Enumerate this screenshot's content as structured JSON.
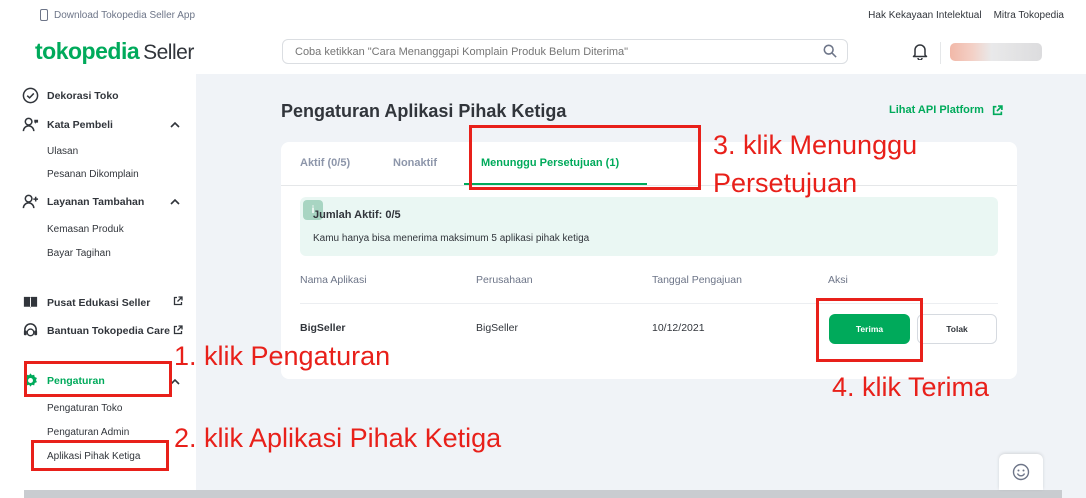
{
  "topbar": {
    "download_app": "Download Tokopedia Seller App",
    "links": [
      "Hak Kekayaan Intelektual",
      "Mitra Tokopedia"
    ]
  },
  "header": {
    "logo_brand": "tokopedia",
    "logo_suffix": "Seller",
    "search_placeholder": "Coba ketikkan \"Cara Menanggapi Komplain Produk Belum Diterima\""
  },
  "sidebar": {
    "dekorasi": "Dekorasi Toko",
    "kata_pembeli": "Kata Pembeli",
    "kata_items": [
      "Ulasan",
      "Pesanan Dikomplain"
    ],
    "layanan": "Layanan Tambahan",
    "layanan_items": [
      "Kemasan Produk",
      "Bayar Tagihan"
    ],
    "edukasi": "Pusat Edukasi Seller",
    "bantuan": "Bantuan Tokopedia Care",
    "pengaturan": "Pengaturan",
    "pengaturan_items": [
      "Pengaturan Toko",
      "Pengaturan Admin",
      "Aplikasi Pihak Ketiga"
    ]
  },
  "main": {
    "title": "Pengaturan Aplikasi Pihak Ketiga",
    "api_link": "Lihat API Platform",
    "tabs": [
      {
        "label": "Aktif (0/5)"
      },
      {
        "label": "Nonaktif"
      },
      {
        "label": "Menunggu Persetujuan (1)",
        "active": true
      }
    ],
    "info": {
      "icon_text": "i",
      "title": "Jumlah Aktif: 0/5",
      "desc": "Kamu hanya bisa menerima maksimum 5 aplikasi pihak ketiga"
    },
    "table": {
      "headers": [
        "Nama Aplikasi",
        "Perusahaan",
        "Tanggal Pengajuan",
        "Aksi"
      ],
      "rows": [
        {
          "app": "BigSeller",
          "company": "BigSeller",
          "date": "10/12/2021",
          "accept": "Terima",
          "reject": "Tolak"
        }
      ]
    }
  },
  "annotations": [
    "1. klik Pengaturan",
    "2. klik Aplikasi Pihak Ketiga",
    "3. klik Menunggu",
    "Persetujuan",
    "4. klik Terima"
  ],
  "colors": {
    "brand_green": "#00aa5b",
    "annotation_red": "#e8201a",
    "page_bg": "#f0f3f7"
  }
}
